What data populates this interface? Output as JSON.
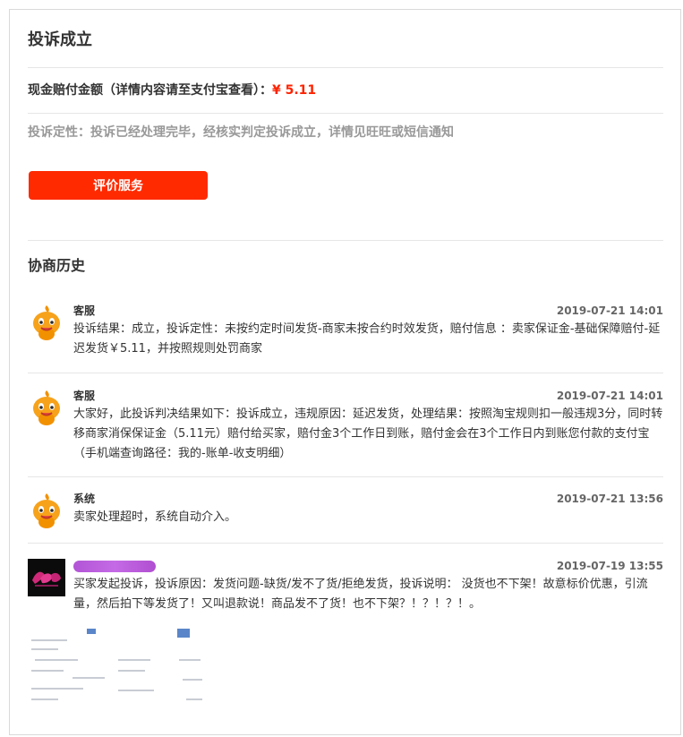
{
  "complaint": {
    "status_title": "投诉成立",
    "amount_label": "现金赔付金额（详情内容请至支付宝查看）：",
    "amount_value": "¥ 5.11",
    "nature_text": "投诉定性：投诉已经处理完毕，经核实判定投诉成立，详情见旺旺或短信通知",
    "rate_button_label": "评价服务"
  },
  "history": {
    "title": "协商历史",
    "records": [
      {
        "name": "客服",
        "time": "2019-07-21 14:01",
        "text": "投诉结果：成立，投诉定性：未按约定时间发货-商家未按合约时效发货，赔付信息 ：卖家保证金-基础保障赔付-延迟发货￥5.11，并按照规则处罚商家",
        "avatar_icon": "service-mascot-icon"
      },
      {
        "name": "客服",
        "time": "2019-07-21 14:01",
        "text": "大家好，此投诉判决结果如下：投诉成立，违规原因：延迟发货，处理结果：按照淘宝规则扣一般违规3分，同时转移商家消保保证金（5.11元）赔付给买家，赔付金3个工作日到账，赔付金会在3个工作日内到账您付款的支付宝（手机端查询路径：我的-账单-收支明细）",
        "avatar_icon": "service-mascot-icon"
      },
      {
        "name": "系统",
        "time": "2019-07-21 13:56",
        "text": "卖家处理超时，系统自动介入。",
        "avatar_icon": "service-mascot-icon"
      },
      {
        "name": "",
        "time": "2019-07-19 13:55",
        "text": "买家发起投诉，投诉原因：发货问题-缺货/发不了货/拒绝发货，投诉说明：  没货也不下架！故意标价优惠，引流量，然后拍下等发货了！又叫退款说！商品发不了货！也不下架？！？！？！。",
        "avatar_icon": "buyer-avatar-icon"
      }
    ]
  },
  "colors": {
    "accent": "#ff2a00",
    "money": "#ff2200",
    "muted_text": "#999999",
    "divider": "#e6e6e6",
    "redaction": "#c060e0"
  }
}
